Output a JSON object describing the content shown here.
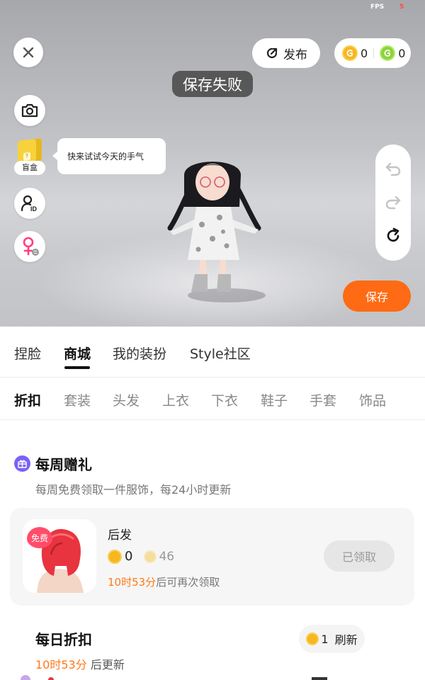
{
  "overlay": {
    "fps_label": "FPS",
    "fps_value": "5",
    "toast": "保存失败"
  },
  "header": {
    "publish_label": "发布",
    "gold_coins": "0",
    "green_coins": "0"
  },
  "left_tools": {
    "mystery_box_label": "盲盒",
    "bubble_text": "快来试试今天的手气"
  },
  "save_label": "保存",
  "main_tabs": [
    {
      "label": "捏脸",
      "active": false
    },
    {
      "label": "商城",
      "active": true
    },
    {
      "label": "我的装扮",
      "active": false
    },
    {
      "label": "Style社区",
      "active": false
    }
  ],
  "sub_tabs": [
    {
      "label": "折扣",
      "active": true
    },
    {
      "label": "套装",
      "active": false
    },
    {
      "label": "头发",
      "active": false
    },
    {
      "label": "上衣",
      "active": false
    },
    {
      "label": "下衣",
      "active": false
    },
    {
      "label": "鞋子",
      "active": false
    },
    {
      "label": "手套",
      "active": false
    },
    {
      "label": "饰品",
      "active": false
    }
  ],
  "weekly_gift": {
    "title": "每周赠礼",
    "subtitle": "每周免费领取一件服饰，每24小时更新",
    "item": {
      "free_badge": "免费",
      "name": "后发",
      "price": "0",
      "original_price": "46",
      "timer": "10时53分",
      "timer_suffix": "后可再次领取",
      "button_label": "已领取"
    }
  },
  "daily_discount": {
    "title": "每日折扣",
    "timer": "10时53分",
    "timer_suffix": " 后更新",
    "refresh_cost": "1",
    "refresh_label": "刷新"
  },
  "colors": {
    "accent": "#ff6a14",
    "timer_orange": "#ff7a1a",
    "gold_coin": "#f7b720",
    "green_coin": "#8bd43a",
    "gift_icon_purple": "#7b61f6"
  }
}
